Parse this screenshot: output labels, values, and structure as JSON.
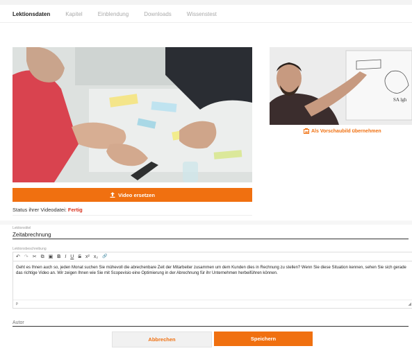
{
  "tabs": [
    {
      "label": "Lektionsdaten",
      "active": true
    },
    {
      "label": "Kapitel",
      "active": false
    },
    {
      "label": "Einblendung",
      "active": false
    },
    {
      "label": "Downloads",
      "active": false
    },
    {
      "label": "Wissenstest",
      "active": false
    }
  ],
  "video": {
    "replace_label": "Video ersetzen",
    "replace_icon": "upload-icon",
    "status_label": "Status ihrer Videodatei:",
    "status_value": "Fertig",
    "status_color": "#d9301c"
  },
  "preview": {
    "link_label": "Als Vorschaubild übernehmen",
    "link_icon": "image-icon",
    "whiteboard_text": "SA lgh"
  },
  "lesson_title": {
    "label": "Lektionstitel",
    "value": "Zeitabrechnung"
  },
  "description": {
    "label": "Lektionsbeschreibung",
    "text": "Geht es Ihnen auch so, jeden Monat suchen Sie mühevoll die abrechenbare Zeit der Mitarbeiter zusammen um dem Kunden dies in Rechnung zu stellen? Wenn Sie diese Situation kennen, sehen Sie sich gerade das richtige Video an. Wir zeigen Ihnen wie Sie mit Scopevisio eine Optimierung in der Abrechnung für ihr Unternehmen herbeiführen können.",
    "footer_tag": "p",
    "toolbar": [
      {
        "name": "undo-icon",
        "glyph": "↶"
      },
      {
        "name": "redo-icon",
        "glyph": "↷"
      },
      {
        "name": "cut-icon",
        "glyph": "✂"
      },
      {
        "name": "copy-icon",
        "glyph": "⧉"
      },
      {
        "name": "paste-icon",
        "glyph": "▣"
      },
      {
        "name": "bold-icon",
        "glyph": "B"
      },
      {
        "name": "italic-icon",
        "glyph": "I"
      },
      {
        "name": "underline-icon",
        "glyph": "U"
      },
      {
        "name": "strikethrough-icon",
        "glyph": "S"
      },
      {
        "name": "superscript-icon",
        "glyph": "x²"
      },
      {
        "name": "subscript-icon",
        "glyph": "x₂"
      },
      {
        "name": "link-icon",
        "glyph": "🔗"
      }
    ]
  },
  "author": {
    "placeholder": "Autor",
    "value": ""
  },
  "actions": {
    "cancel_label": "Abbrechen",
    "save_label": "Speichern"
  },
  "colors": {
    "accent": "#f07010"
  }
}
